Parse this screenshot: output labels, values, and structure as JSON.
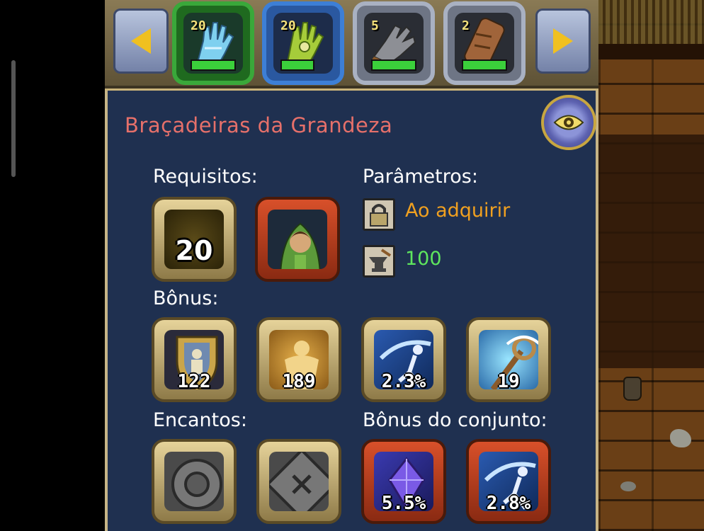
{
  "carousel": {
    "items": [
      {
        "count": "20",
        "frame": "green",
        "icon": "ice-glove-icon"
      },
      {
        "count": "20",
        "frame": "blue",
        "icon": "green-glove-icon"
      },
      {
        "count": "5",
        "frame": "grey",
        "icon": "iron-gauntlet-icon"
      },
      {
        "count": "2",
        "frame": "grey",
        "icon": "leather-bracer-icon"
      }
    ],
    "prev_icon": "arrow-left-icon",
    "next_icon": "arrow-right-icon"
  },
  "item": {
    "name": "Braçadeiras da Grandeza",
    "name_color": "#e6706a"
  },
  "labels": {
    "requirements": "Requisitos:",
    "parameters": "Parâmetros:",
    "bonus": "Bônus:",
    "enchants": "Encantos:",
    "set_bonus": "Bônus do conjunto:"
  },
  "requirements": {
    "level": "20",
    "class_icon": "ranger-class-icon"
  },
  "parameters": {
    "bind": "Ao adquirir",
    "bind_color": "#f0a020",
    "durability": "100",
    "durability_color": "#5ee65e"
  },
  "bonus": [
    {
      "value": "122",
      "icon": "armor-shield-icon"
    },
    {
      "value": "189",
      "icon": "health-figure-icon"
    },
    {
      "value": "2.3%",
      "icon": "dodge-icon"
    },
    {
      "value": "19",
      "icon": "staff-icon"
    }
  ],
  "enchants": [
    {
      "icon": "empty-rune-round-icon"
    },
    {
      "icon": "empty-rune-square-icon"
    }
  ],
  "set_bonus": [
    {
      "value": "5.5%",
      "icon": "crystal-icon"
    },
    {
      "value": "2.8%",
      "icon": "dodge-icon"
    }
  ]
}
